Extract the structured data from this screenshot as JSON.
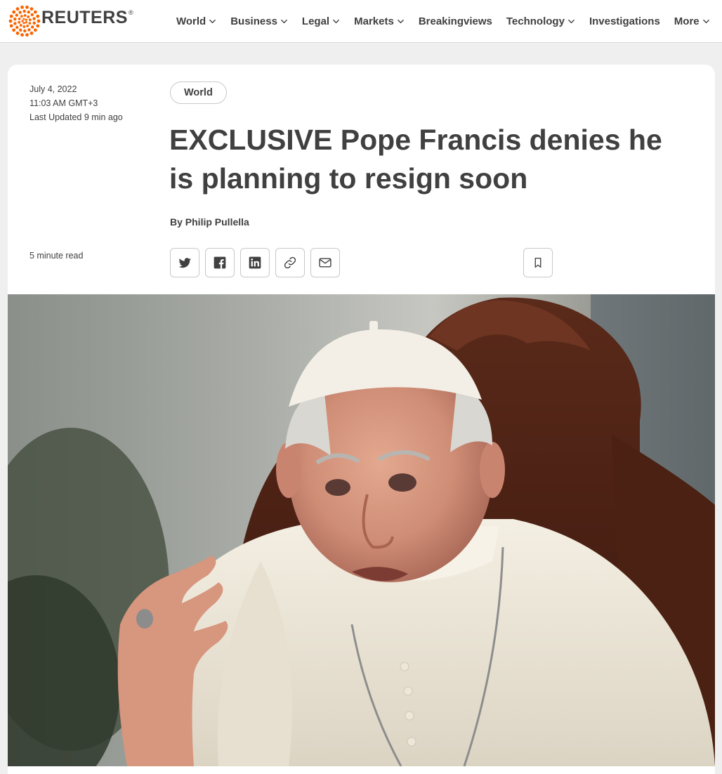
{
  "header": {
    "brand": "REUTERS",
    "brand_mark": "®",
    "nav": [
      {
        "label": "World",
        "has_menu": true
      },
      {
        "label": "Business",
        "has_menu": true
      },
      {
        "label": "Legal",
        "has_menu": true
      },
      {
        "label": "Markets",
        "has_menu": true
      },
      {
        "label": "Breakingviews",
        "has_menu": false
      },
      {
        "label": "Technology",
        "has_menu": true
      },
      {
        "label": "Investigations",
        "has_menu": false
      },
      {
        "label": "More",
        "has_menu": true
      }
    ]
  },
  "article": {
    "date": "July 4, 2022",
    "time": "11:03 AM GMT+3",
    "updated": "Last Updated 9 min ago",
    "read_time": "5 minute read",
    "section_tag": "World",
    "headline": "EXCLUSIVE Pope Francis denies he is planning to resign soon",
    "byline": "By Philip Pullella",
    "share_icons": [
      "twitter-icon",
      "facebook-icon",
      "linkedin-icon",
      "link-icon",
      "email-icon"
    ],
    "bookmark_icon": "bookmark-icon"
  },
  "colors": {
    "text": "#404040",
    "brand_orange": "#fa6400",
    "border": "#c8c8c8",
    "page_bg": "#efefef"
  }
}
